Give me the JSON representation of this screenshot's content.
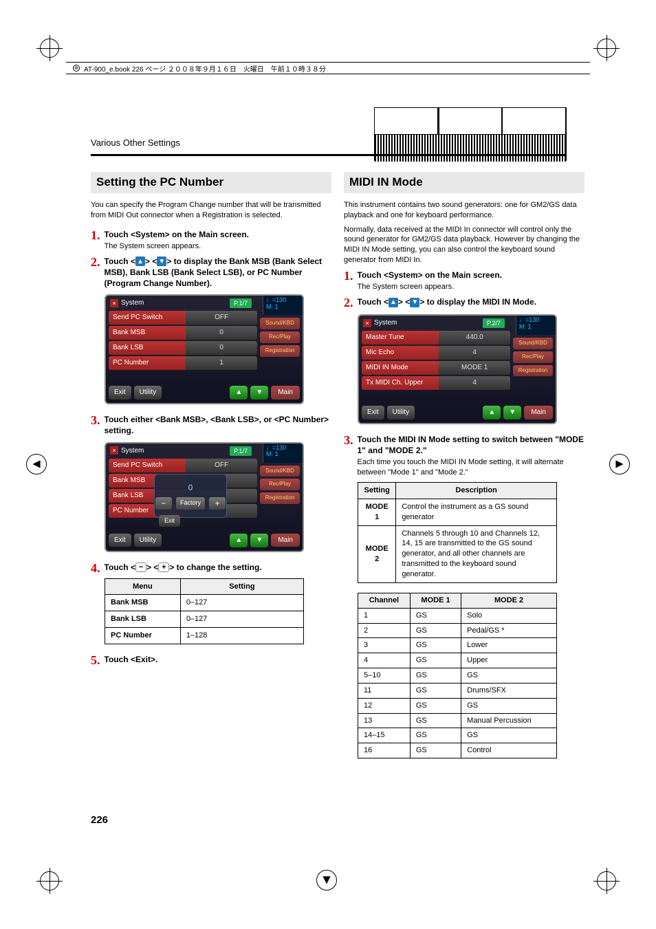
{
  "header": {
    "book_ref": "AT-900_e.book  226 ページ  ２００８年９月１６日　火曜日　午前１０時３８分"
  },
  "running_head": "Various Other Settings",
  "page_number": "226",
  "left": {
    "section_title": "Setting the PC Number",
    "intro": "You can specify the Program Change number that will be transmitted from MIDI Out connector when a Registration is selected.",
    "steps": {
      "s1_bold": "Touch <System> on the Main screen.",
      "s1_sub": "The System screen appears.",
      "s2_bold_a": "Touch <",
      "s2_bold_b": "> <",
      "s2_bold_c": "> to display the Bank MSB (Bank Select MSB), Bank LSB (Bank Select LSB), or PC Number (Program Change Number).",
      "s3_bold": "Touch either <Bank MSB>, <Bank LSB>, or <PC Number> setting.",
      "s4_bold_a": "Touch <",
      "s4_bold_b": "> <",
      "s4_bold_c": "> to change the setting.",
      "s5_bold": "Touch <Exit>."
    },
    "screenshot1": {
      "title": "System",
      "page": "P.1/7",
      "tempo": "♩=130",
      "measure": "M:   1",
      "rows": [
        {
          "lab": "Send PC Switch",
          "val": "OFF"
        },
        {
          "lab": "Bank MSB",
          "val": "0"
        },
        {
          "lab": "Bank LSB",
          "val": "0"
        },
        {
          "lab": "PC Number",
          "val": "1"
        }
      ],
      "side": [
        "Sound/KBD",
        "Rec/Play",
        "Registration"
      ],
      "exit": "Exit",
      "utility": "Utility",
      "main": "Main"
    },
    "screenshot2": {
      "title": "System",
      "page": "P.1/7",
      "tempo": "♩=130",
      "measure": "M:   1",
      "rows": [
        {
          "lab": "Send PC Switch",
          "val": "OFF"
        },
        {
          "lab": "Bank MSB",
          "val": ""
        },
        {
          "lab": "Bank LSB",
          "val": ""
        },
        {
          "lab": "PC Number",
          "val": ""
        }
      ],
      "popup_val": "0",
      "factory": "Factory",
      "popup_exit": "Exit",
      "side": [
        "Sound/KBD",
        "Rec/Play",
        "Registration"
      ],
      "exit": "Exit",
      "utility": "Utility",
      "main": "Main"
    },
    "menu_table": {
      "headers": [
        "Menu",
        "Setting"
      ],
      "rows": [
        [
          "Bank MSB",
          "0–127"
        ],
        [
          "Bank LSB",
          "0–127"
        ],
        [
          "PC Number",
          "1–128"
        ]
      ]
    }
  },
  "right": {
    "section_title": "MIDI IN Mode",
    "intro1": "This instrument contains two sound generators: one for GM2/GS data playback and one for keyboard performance.",
    "intro2": "Normally, data received at the MIDI In connector will control only the sound generator for GM2/GS data playback. However by changing the MIDI IN Mode setting, you can also control the keyboard sound generator from MIDI In.",
    "steps": {
      "s1_bold": "Touch <System> on the Main screen.",
      "s1_sub": "The System screen appears.",
      "s2_bold_a": "Touch <",
      "s2_bold_b": "> <",
      "s2_bold_c": "> to display the MIDI IN Mode.",
      "s3_bold": "Touch the MIDI IN Mode setting to switch between \"MODE 1\" and \"MODE 2.\"",
      "s3_sub": "Each time you touch the MIDI IN Mode setting, it will alternate between \"Mode 1\" and \"Mode 2.\""
    },
    "screenshot": {
      "title": "System",
      "page": "P.2/7",
      "tempo": "♩=130",
      "measure": "M:   1",
      "rows": [
        {
          "lab": "Master Tune",
          "val": "440.0"
        },
        {
          "lab": "Mic Echo",
          "val": "4"
        },
        {
          "lab": "MIDI IN Mode",
          "val": "MODE 1"
        },
        {
          "lab": "Tx MIDI Ch. Upper",
          "val": "4"
        }
      ],
      "side": [
        "Sound/KBD",
        "Rec/Play",
        "Registration"
      ],
      "exit": "Exit",
      "utility": "Utility",
      "main": "Main"
    },
    "mode_table": {
      "headers": [
        "Setting",
        "Description"
      ],
      "rows": [
        [
          "MODE 1",
          "Control the instrument as a GS sound generator"
        ],
        [
          "MODE 2",
          "Channels 5 through 10 and Channels 12, 14, 15 are transmitted to the GS sound generator, and all other channels are transmitted to the keyboard sound generator."
        ]
      ]
    },
    "channel_table": {
      "headers": [
        "Channel",
        "MODE 1",
        "MODE 2"
      ],
      "rows": [
        [
          "1",
          "GS",
          "Solo"
        ],
        [
          "2",
          "GS",
          "Pedal/GS *"
        ],
        [
          "3",
          "GS",
          "Lower"
        ],
        [
          "4",
          "GS",
          "Upper"
        ],
        [
          "5–10",
          "GS",
          "GS"
        ],
        [
          "11",
          "GS",
          "Drums/SFX"
        ],
        [
          "12",
          "GS",
          "GS"
        ],
        [
          "13",
          "GS",
          "Manual Percussion"
        ],
        [
          "14–15",
          "GS",
          "GS"
        ],
        [
          "16",
          "GS",
          "Control"
        ]
      ]
    }
  },
  "chart_data": {
    "type": "table",
    "title": "MIDI IN Mode channel assignment",
    "columns": [
      "Channel",
      "MODE 1",
      "MODE 2"
    ],
    "rows": [
      [
        "1",
        "GS",
        "Solo"
      ],
      [
        "2",
        "GS",
        "Pedal/GS *"
      ],
      [
        "3",
        "GS",
        "Lower"
      ],
      [
        "4",
        "GS",
        "Upper"
      ],
      [
        "5–10",
        "GS",
        "GS"
      ],
      [
        "11",
        "GS",
        "Drums/SFX"
      ],
      [
        "12",
        "GS",
        "GS"
      ],
      [
        "13",
        "GS",
        "Manual Percussion"
      ],
      [
        "14–15",
        "GS",
        "GS"
      ],
      [
        "16",
        "GS",
        "Control"
      ]
    ]
  }
}
